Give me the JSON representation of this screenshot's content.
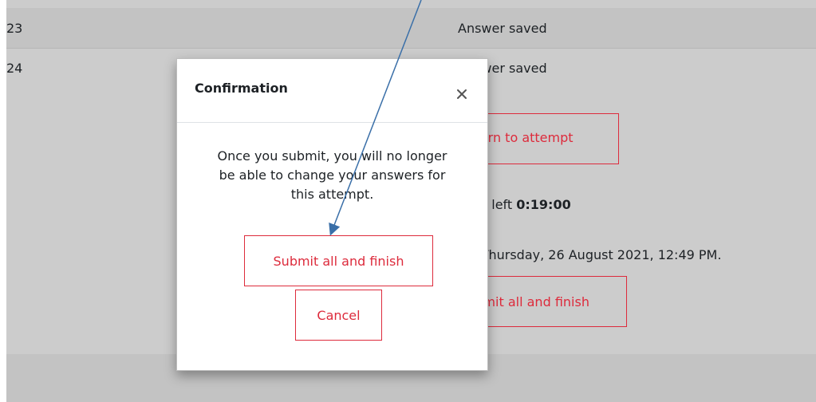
{
  "table": {
    "rows": [
      {
        "number": "23",
        "status": "Answer saved"
      },
      {
        "number": "24",
        "status": "Answer saved"
      }
    ]
  },
  "background": {
    "return_label": "Return to attempt",
    "time_left_label": "Time left",
    "time_left_value": "0:19:00",
    "deadline_text": "by Thursday, 26 August 2021, 12:49 PM.",
    "submit_label": "Submit all and finish"
  },
  "modal": {
    "title": "Confirmation",
    "message": "Once you submit, you will no longer be able to change your answers for this attempt.",
    "submit_label": "Submit all and finish",
    "cancel_label": "Cancel",
    "close_icon": "close-icon"
  },
  "colors": {
    "accent": "#dd2b3c",
    "overlay": "#cccccc",
    "annotation_arrow": "#3a6fa8"
  }
}
